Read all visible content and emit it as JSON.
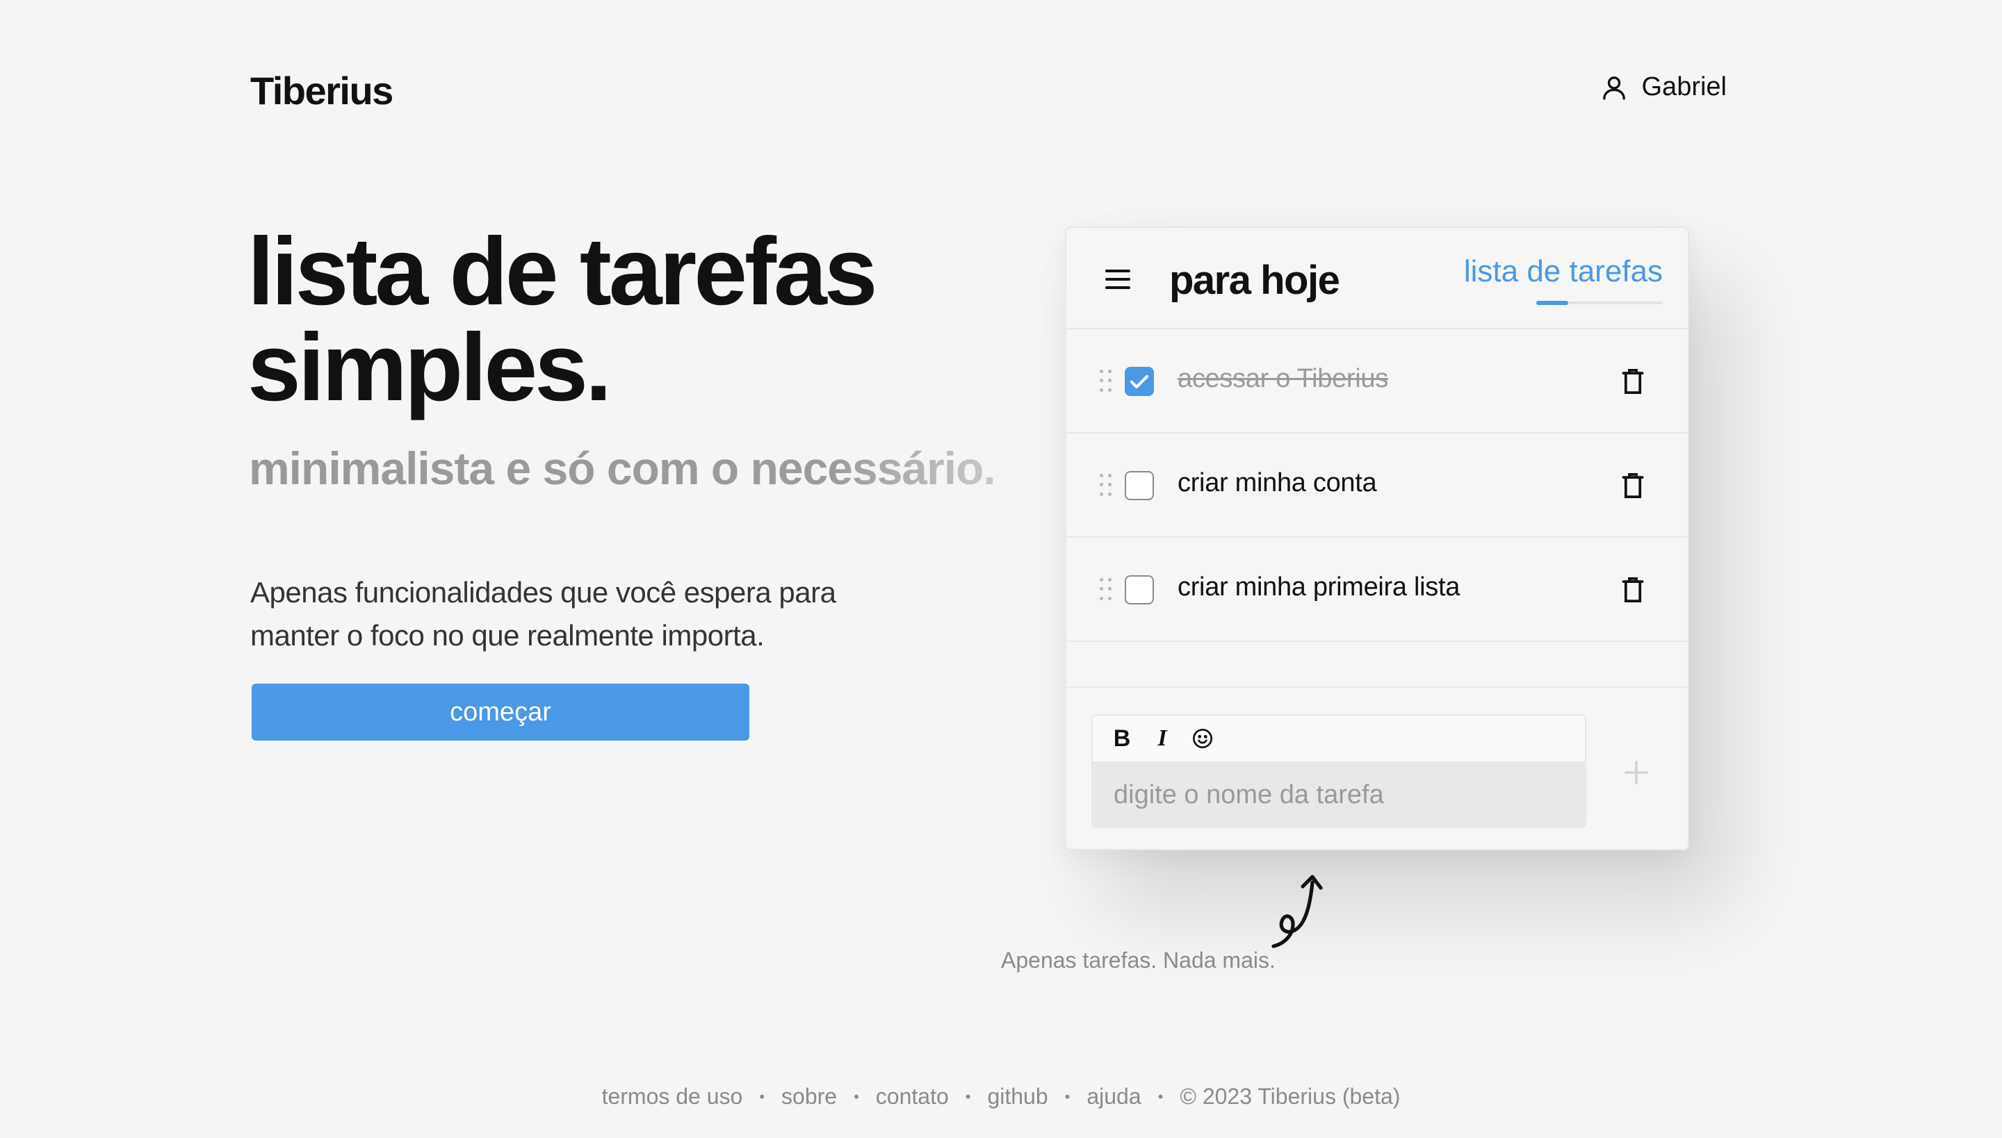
{
  "header": {
    "logo": "Tiberius",
    "user_name": "Gabriel",
    "user_icon": "user-icon"
  },
  "hero": {
    "title_line1": "lista de tarefas",
    "title_line2": "simples.",
    "subtitle": "minimalista e só com o necessário.",
    "description": "Apenas funcionalidades que você espera para manter o foco no que realmente importa.",
    "cta_label": "começar"
  },
  "card": {
    "title": "para hoje",
    "tab_label": "lista de tarefas",
    "tasks": [
      {
        "label": "acessar o Tiberius",
        "done": true
      },
      {
        "label": "criar minha conta",
        "done": false
      },
      {
        "label": "criar minha primeira lista",
        "done": false
      }
    ],
    "input_placeholder": "digite o nome da tarefa",
    "toolbar": {
      "bold": "B",
      "italic": "I",
      "emoji_icon": "smiley-icon"
    }
  },
  "note": "Apenas tarefas. Nada mais.",
  "footer": {
    "links": [
      "termos de uso",
      "sobre",
      "contato",
      "github",
      "ajuda"
    ],
    "copyright": "© 2023 Tiberius (beta)"
  },
  "colors": {
    "accent": "#4a98e6",
    "background": "#f5f5f5",
    "text": "#111111",
    "muted": "#8a8a8a"
  }
}
